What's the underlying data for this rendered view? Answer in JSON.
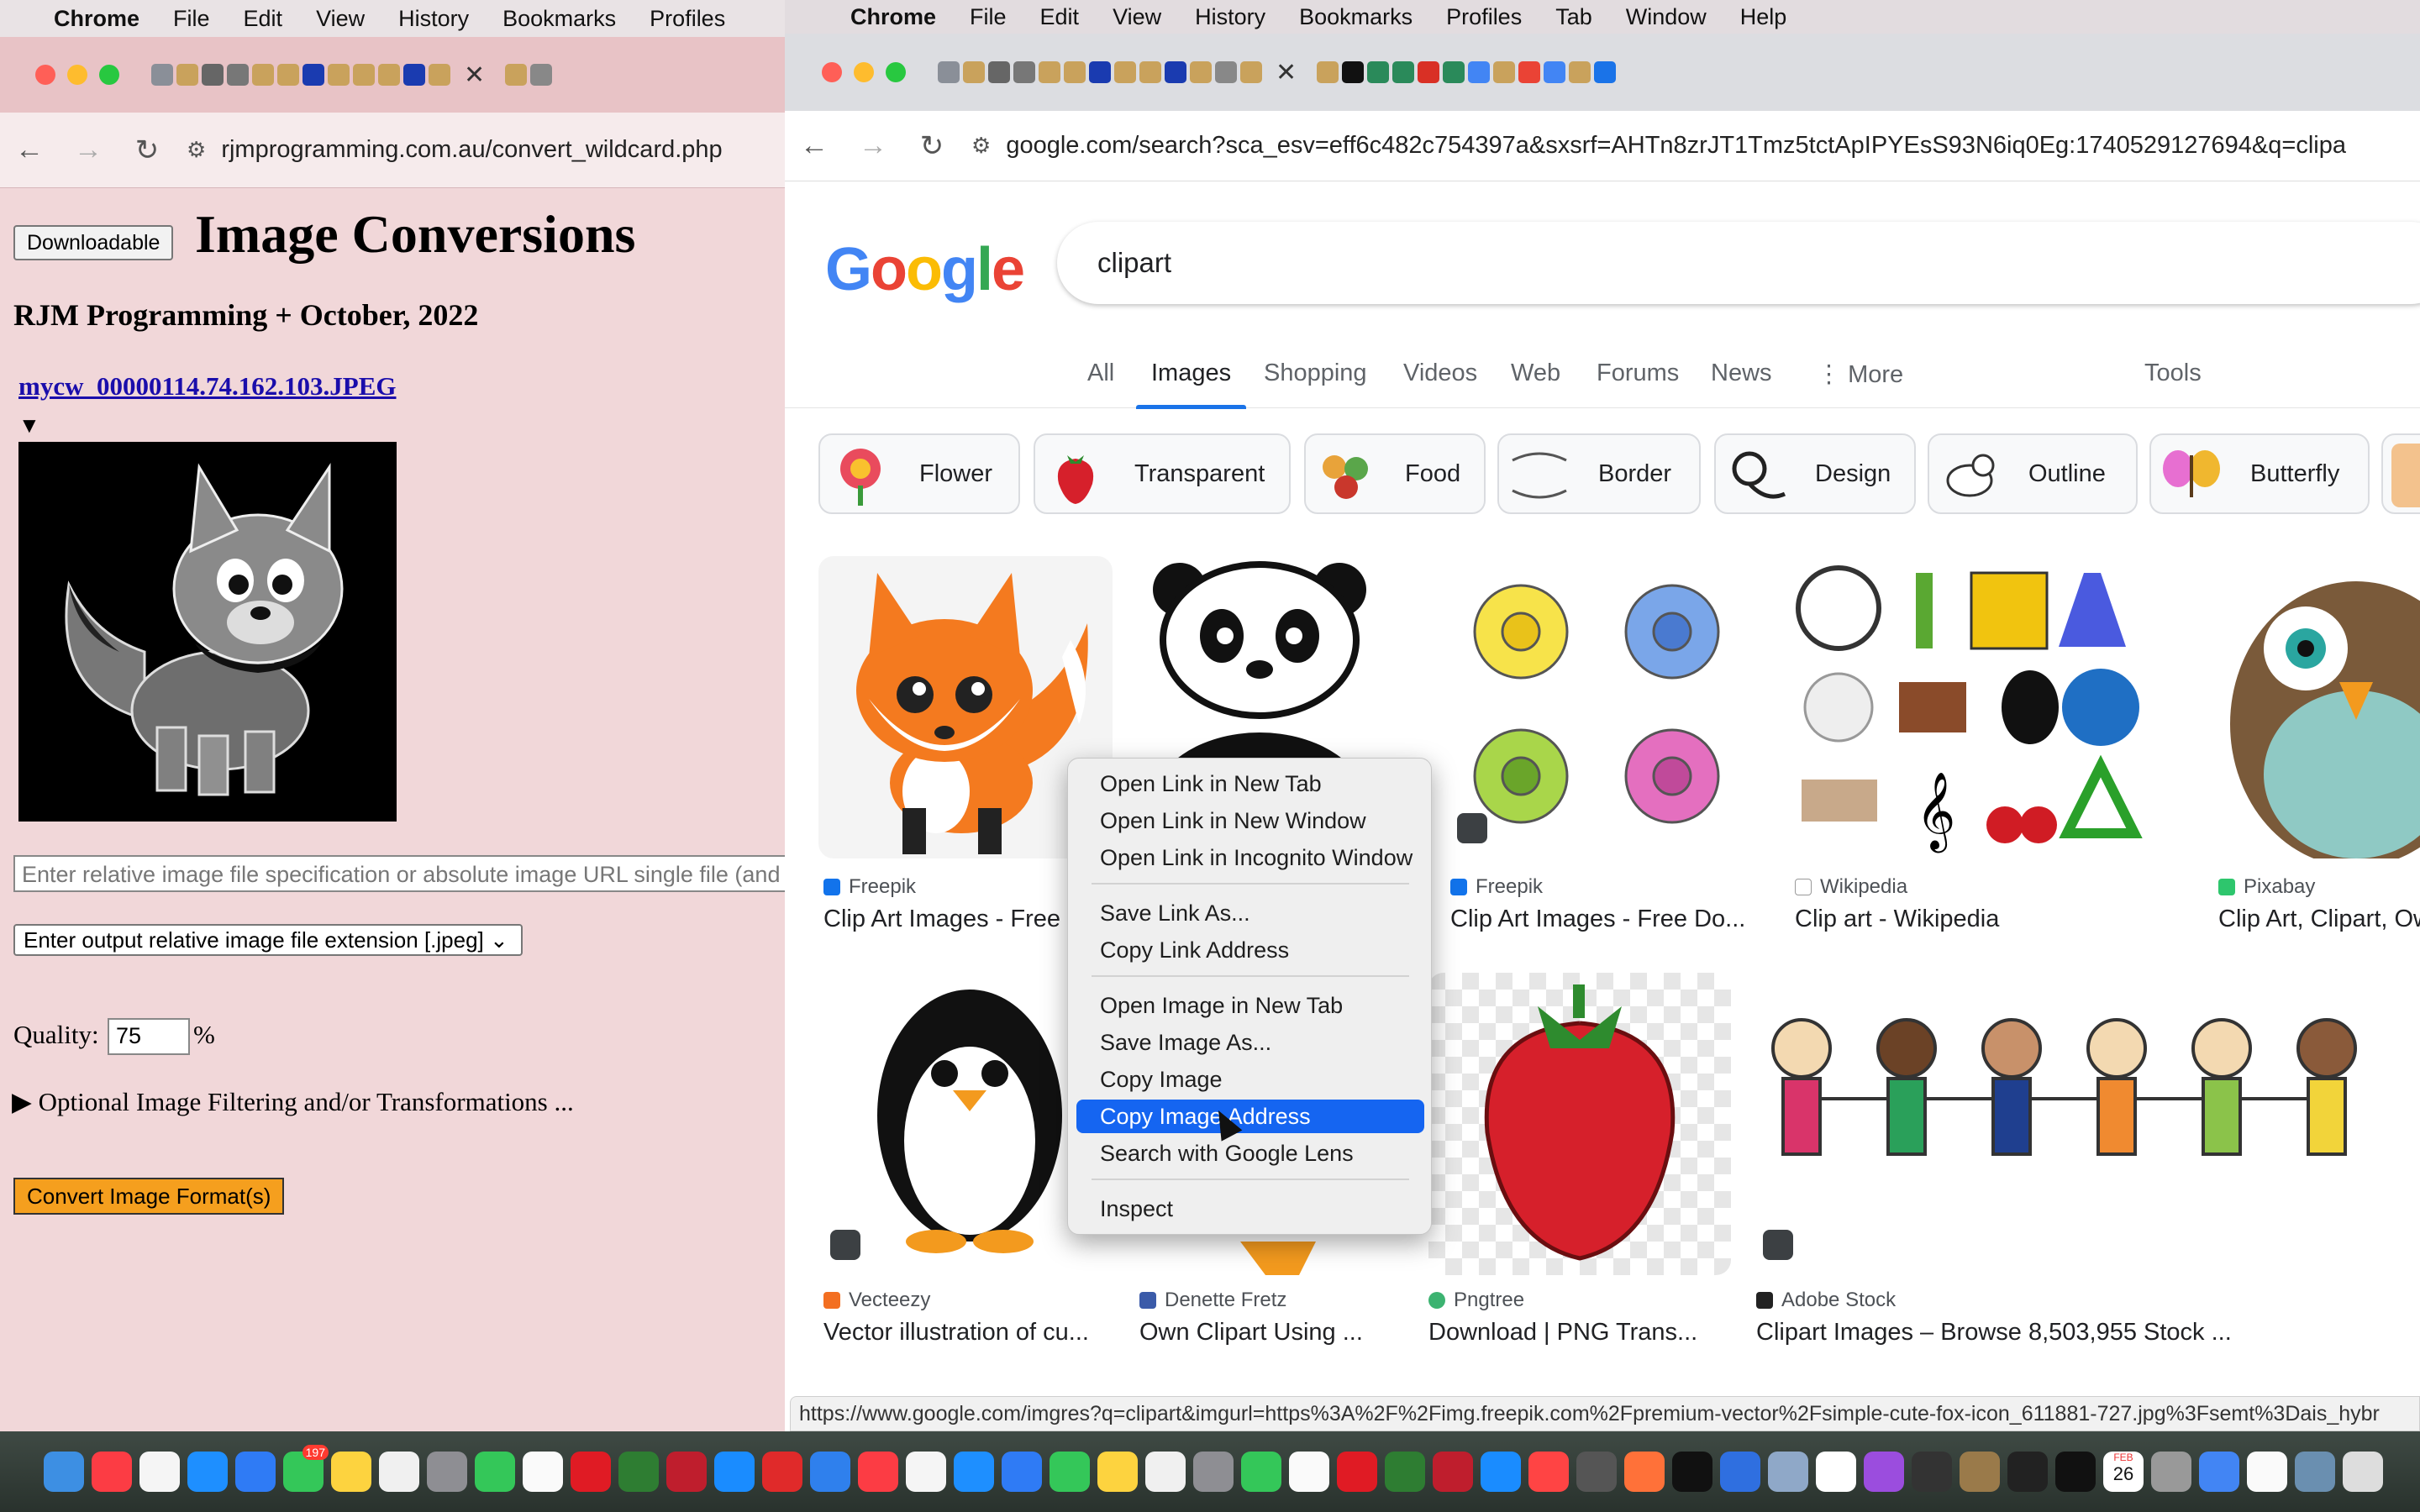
{
  "left_window": {
    "menu": [
      "Chrome",
      "File",
      "Edit",
      "View",
      "History",
      "Bookmarks",
      "Profiles"
    ],
    "url": "rjmprogramming.com.au/convert_wildcard.php",
    "page": {
      "downloadable_label": "Downloadable",
      "heading": "Image Conversions",
      "subheading": "RJM Programming + October, 2022",
      "file_link": "mycw_00000114.74.162.103.JPEG",
      "image_input_placeholder": "Enter relative image file specification or absolute image URL single file (and m",
      "extension_select": "Enter output relative image file extension [.jpeg]",
      "quality_label": "Quality:",
      "quality_value": "75",
      "quality_unit": "%",
      "optional_label": "Optional Image Filtering and/or Transformations ...",
      "convert_label": "Convert Image Format(s)"
    }
  },
  "right_window": {
    "menu": [
      "Chrome",
      "File",
      "Edit",
      "View",
      "History",
      "Bookmarks",
      "Profiles",
      "Tab",
      "Window",
      "Help"
    ],
    "url": "google.com/search?sca_esv=eff6c482c754397a&sxsrf=AHTn8zrJT1Tmz5tctApIPYEsS93N6iq0Eg:1740529127694&q=clipa",
    "search_query": "clipart",
    "nav_tabs": [
      "All",
      "Images",
      "Shopping",
      "Videos",
      "Web",
      "Forums",
      "News",
      "More",
      "Tools"
    ],
    "chips": [
      "Flower",
      "Transparent",
      "Food",
      "Border",
      "Design",
      "Outline",
      "Butterfly"
    ],
    "results": [
      {
        "source": "Freepik",
        "title": "Clip Art Images - Free"
      },
      {
        "source": "Freepik",
        "title": "Clip Art Images - Free Do..."
      },
      {
        "source": "Wikipedia",
        "title": "Clip art - Wikipedia"
      },
      {
        "source": "Pixabay",
        "title": "Clip Art, Clipart, Ow"
      },
      {
        "source": "Vecteezy",
        "title": "Vector illustration of cu..."
      },
      {
        "source": "Denette Fretz",
        "title": "Own Clipart Using ..."
      },
      {
        "source": "Pngtree",
        "title": "Download | PNG Trans..."
      },
      {
        "source": "Adobe Stock",
        "title": "Clipart Images – Browse 8,503,955 Stock ..."
      }
    ],
    "context_menu": [
      "Open Link in New Tab",
      "Open Link in New Window",
      "Open Link in Incognito Window",
      "Save Link As...",
      "Copy Link Address",
      "Open Image in New Tab",
      "Save Image As...",
      "Copy Image",
      "Copy Image Address",
      "Search with Google Lens",
      "Inspect"
    ],
    "context_menu_highlighted": "Copy Image Address",
    "status_url": "https://www.google.com/imgres?q=clipart&imgurl=https%3A%2F%2Fimg.freepik.com%2Fpremium-vector%2Fsimple-cute-fox-icon_611881-727.jpg%3Fsemt%3Dais_hybr"
  },
  "dock": {
    "calendar_month": "FEB",
    "calendar_day": "26",
    "messages_badge": "197"
  },
  "colors": {
    "accent_blue": "#1a73e8",
    "menu_highlight": "#1565f1",
    "convert_button": "#f59f1e",
    "left_page_bg": "#f1d7d9"
  }
}
